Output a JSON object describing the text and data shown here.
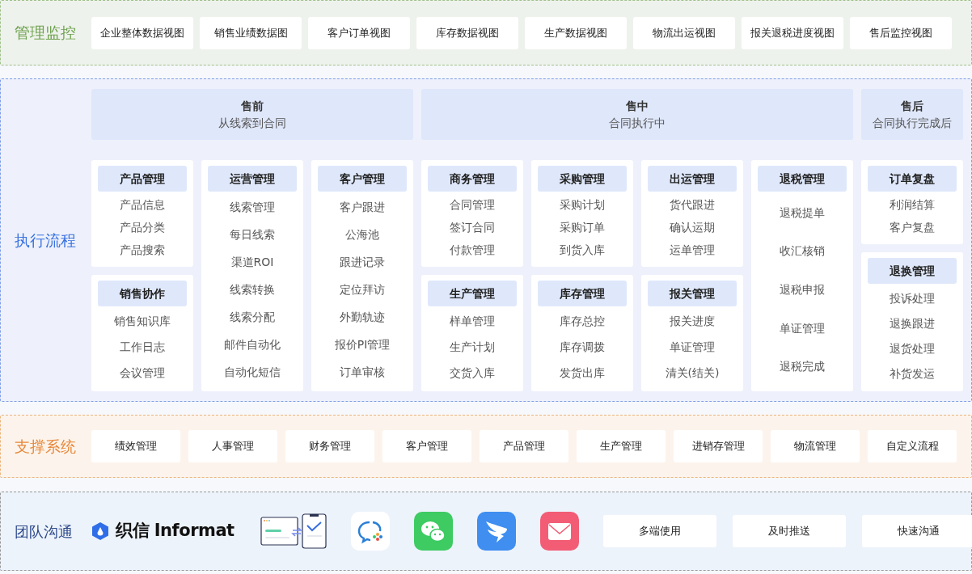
{
  "management": {
    "title": "管理监控",
    "views": [
      "企业整体数据视图",
      "销售业绩数据图",
      "客户订单视图",
      "库存数据视图",
      "生产数据视图",
      "物流出运视图",
      "报关退税进度视图",
      "售后监控视图"
    ]
  },
  "execution": {
    "title": "执行流程",
    "phases": [
      {
        "name": "售前",
        "subtitle": "从线索到合同",
        "columns": [
          [
            {
              "title": "产品管理",
              "items": [
                "产品信息",
                "产品分类",
                "产品搜索"
              ]
            },
            {
              "title": "销售协作",
              "items": [
                "销售知识库",
                "工作日志",
                "会议管理"
              ]
            }
          ],
          [
            {
              "title": "运营管理",
              "items": [
                "线索管理",
                "每日线索",
                "渠道ROI",
                "线索转换",
                "线索分配",
                "邮件自动化",
                "自动化短信"
              ]
            }
          ],
          [
            {
              "title": "客户管理",
              "items": [
                "客户跟进",
                "公海池",
                "跟进记录",
                "定位拜访",
                "外勤轨迹",
                "报价PI管理",
                "订单审核"
              ]
            }
          ]
        ]
      },
      {
        "name": "售中",
        "subtitle": "合同执行中",
        "columns": [
          [
            {
              "title": "商务管理",
              "items": [
                "合同管理",
                "签订合同",
                "付款管理"
              ]
            },
            {
              "title": "生产管理",
              "items": [
                "样单管理",
                "生产计划",
                "交货入库"
              ]
            }
          ],
          [
            {
              "title": "采购管理",
              "items": [
                "采购计划",
                "采购订单",
                "到货入库"
              ]
            },
            {
              "title": "库存管理",
              "items": [
                "库存总控",
                "库存调拨",
                "发货出库"
              ]
            }
          ],
          [
            {
              "title": "出运管理",
              "items": [
                "货代跟进",
                "确认运期",
                "运单管理"
              ]
            },
            {
              "title": "报关管理",
              "items": [
                "报关进度",
                "单证管理",
                "清关(结关)"
              ]
            }
          ],
          [
            {
              "title": "退税管理",
              "items": [
                "退税提单",
                "收汇核销",
                "退税申报",
                "单证管理",
                "退税完成"
              ]
            }
          ]
        ]
      },
      {
        "name": "售后",
        "subtitle": "合同执行完成后",
        "columns": [
          [
            {
              "title": "订单复盘",
              "items": [
                "利润结算",
                "客户复盘"
              ]
            },
            {
              "title": "退换管理",
              "items": [
                "投诉处理",
                "退换跟进",
                "退货处理",
                "补货发运"
              ]
            }
          ]
        ]
      }
    ]
  },
  "support": {
    "title": "支撑系统",
    "systems": [
      "绩效管理",
      "人事管理",
      "财务管理",
      "客户管理",
      "产品管理",
      "生产管理",
      "进销存管理",
      "物流管理",
      "自定义流程"
    ]
  },
  "communication": {
    "title": "团队沟通",
    "brand": "织信 Informat",
    "features": [
      "多端使用",
      "及时推送",
      "快速沟通"
    ]
  }
}
